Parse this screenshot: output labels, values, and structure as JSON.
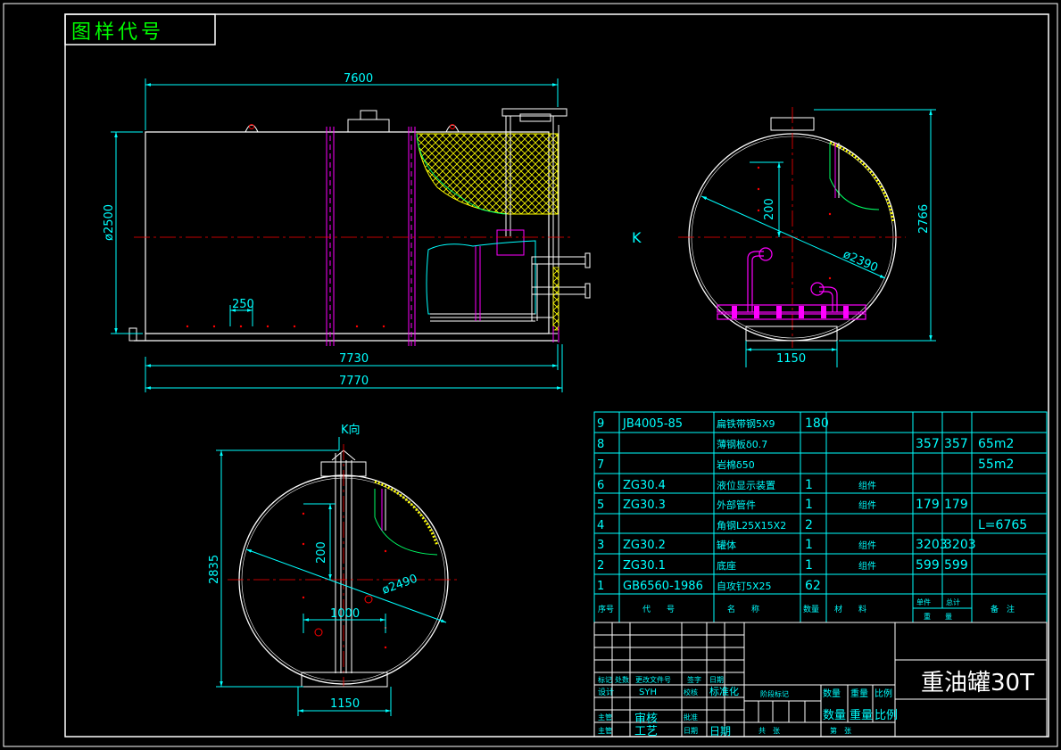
{
  "title_box": {
    "label": "图样代号"
  },
  "front_view": {
    "dims": {
      "overall_top": "7600",
      "diameter_left": "ø2500",
      "spacing": "250",
      "length_inner": "7730",
      "length_overall": "7770"
    }
  },
  "side_view": {
    "view_marker": "K",
    "dims": {
      "height": "2766",
      "inner_200": "200",
      "diameter": "ø2390",
      "base_width": "1150"
    }
  },
  "bottom_view": {
    "title": "K向",
    "dims": {
      "height": "2835",
      "inner_200": "200",
      "diameter": "ø2490",
      "offset": "1000",
      "base_width": "1150"
    }
  },
  "bom": {
    "rows": [
      {
        "no": "9",
        "code": "JB4005-85",
        "name": "扁铁带钢5X9",
        "qty": "180",
        "mat": "",
        "unit_w": "",
        "total_w": "",
        "note": ""
      },
      {
        "no": "8",
        "code": "",
        "name": "薄钢板δ0.7",
        "qty": "",
        "mat": "",
        "unit_w": "357",
        "total_w": "357",
        "note": "65m2"
      },
      {
        "no": "7",
        "code": "",
        "name": "岩棉δ50",
        "qty": "",
        "mat": "",
        "unit_w": "",
        "total_w": "",
        "note": "55m2"
      },
      {
        "no": "6",
        "code": "ZG30.4",
        "name": "液位显示装置",
        "qty": "1",
        "mat": "组件",
        "unit_w": "",
        "total_w": "",
        "note": ""
      },
      {
        "no": "5",
        "code": "ZG30.3",
        "name": "外部管件",
        "qty": "1",
        "mat": "组件",
        "unit_w": "179",
        "total_w": "179",
        "note": ""
      },
      {
        "no": "4",
        "code": "",
        "name": "角钢L25X15X2",
        "qty": "2",
        "mat": "",
        "unit_w": "",
        "total_w": "",
        "note": "L=6765"
      },
      {
        "no": "3",
        "code": "ZG30.2",
        "name": "罐体",
        "qty": "1",
        "mat": "组件",
        "unit_w": "3203",
        "total_w": "3203",
        "note": ""
      },
      {
        "no": "2",
        "code": "ZG30.1",
        "name": "底座",
        "qty": "1",
        "mat": "组件",
        "unit_w": "599",
        "total_w": "599",
        "note": ""
      },
      {
        "no": "1",
        "code": "GB6560-1986",
        "name": "自攻钉5X25",
        "qty": "62",
        "mat": "",
        "unit_w": "",
        "total_w": "",
        "note": ""
      }
    ],
    "header": {
      "no": "序号",
      "code": "代　　号",
      "name": "名　　称",
      "qty": "数量",
      "mat": "材　　料",
      "unit_w": "单件",
      "total_w": "总计",
      "weight": "重　　量",
      "note": "备　注"
    }
  },
  "title_block": {
    "drawing_title": "重油罐30T",
    "design": "设计",
    "designer": "SYH",
    "standard": "标准化",
    "review": "审核",
    "craft": "工艺",
    "date": "日期",
    "stage_mark": "阶段标记",
    "qty": "数量",
    "weight": "重量",
    "scale": "比例",
    "sheet_total": "共　张",
    "sheet_no": "第　张",
    "marks": [
      "标记",
      "处数",
      "更改文件号",
      "签字",
      "日期"
    ],
    "misc": [
      "校核",
      "主管",
      "批准"
    ]
  },
  "colors": {
    "frame": "#ffffff",
    "dim": "#00ffff",
    "hatch": "#ffff00",
    "center": "#ff0000",
    "magenta": "#ff00ff",
    "text_green": "#00ff00",
    "curve_green": "#00ff66"
  }
}
